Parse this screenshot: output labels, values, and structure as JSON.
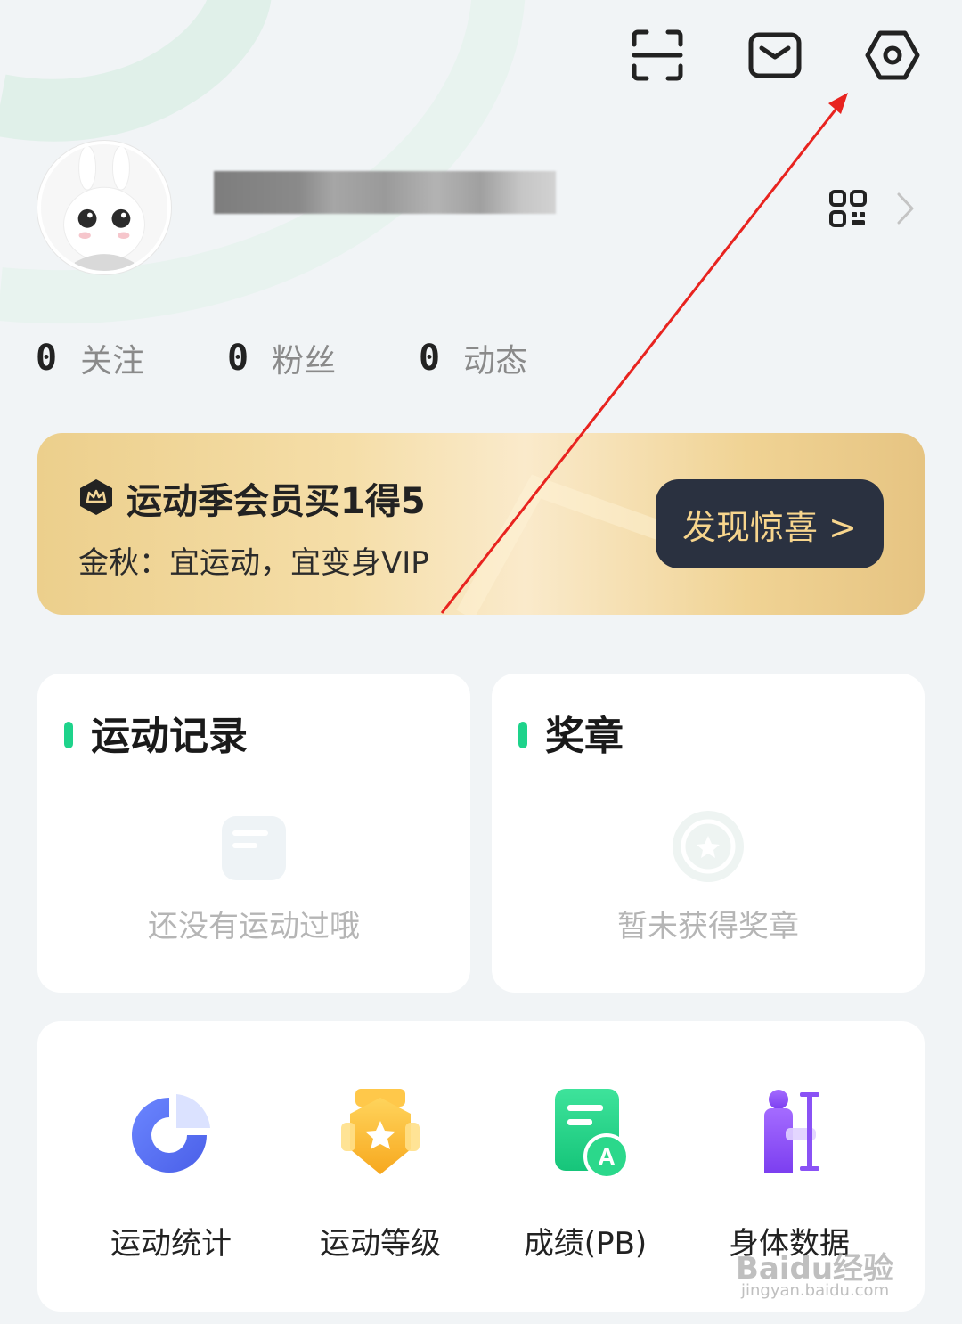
{
  "header": {
    "icons": [
      "scan-icon",
      "mail-icon",
      "settings-icon"
    ]
  },
  "profile": {
    "username_hidden": true
  },
  "stats": [
    {
      "count": "0",
      "label": "关注"
    },
    {
      "count": "0",
      "label": "粉丝"
    },
    {
      "count": "0",
      "label": "动态"
    }
  ],
  "vip_banner": {
    "title": "运动季会员买1得5",
    "subtitle": "金秋：宜运动，宜变身VIP",
    "button": "发现惊喜 >"
  },
  "records_card": {
    "title": "运动记录",
    "empty_text": "还没有运动过哦"
  },
  "medals_card": {
    "title": "奖章",
    "empty_text": "暂未获得奖章"
  },
  "tools": [
    {
      "label": "运动统计",
      "icon": "pie-chart-icon"
    },
    {
      "label": "运动等级",
      "icon": "level-badge-icon"
    },
    {
      "label": "成绩(PB)",
      "icon": "score-document-icon"
    },
    {
      "label": "身体数据",
      "icon": "body-data-icon"
    }
  ],
  "watermark": {
    "brand": "Baidu经验",
    "url": "jingyan.baidu.com"
  },
  "colors": {
    "accent_green": "#1ed38b",
    "vip_gold": "#f0d394",
    "vip_button": "#2a3140",
    "annotation_red": "#e8231f"
  }
}
